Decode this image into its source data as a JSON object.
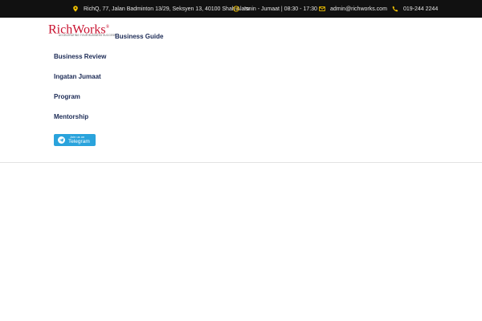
{
  "topbar": {
    "address": "RichQ, 77, Jalan Badminton 13/29, Seksyen 13, 40100 Shah Alam",
    "hours": "Isnin - Jumaat | 08:30 - 17:30",
    "email": "admin@richworks.com",
    "phone": "019-244 2244",
    "icons": [
      "map-pin-icon",
      "clock-icon",
      "mail-icon",
      "phone-icon"
    ],
    "icon_color": "#f2c200"
  },
  "logo": {
    "wordmark": "RichWorks",
    "registered": "®",
    "tagline": "ACCELERATING YOUR BUSINESS SUCCESS",
    "color": "#c8102e"
  },
  "nav": {
    "items": [
      "Business Guide",
      "Business Review",
      "Ingatan Jumaat",
      "Program",
      "Mentorship"
    ],
    "color": "#1b2a55"
  },
  "telegram": {
    "small_text": "Join us on",
    "big_text": "Telegram",
    "color": "#2aa3dc"
  }
}
